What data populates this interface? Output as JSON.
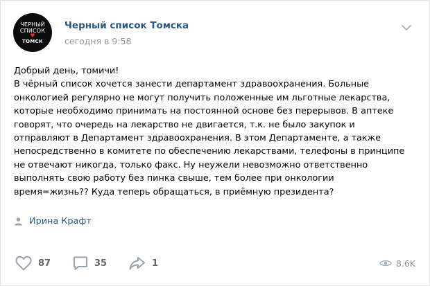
{
  "post": {
    "avatar": {
      "line1": "ЧЕРНЫЙ",
      "line2": "СПИСОК",
      "line3": "ТОМСК"
    },
    "author": "Черный список Томска",
    "date": "сегодня в 9:58",
    "text": "Добрый день, томичи!\nВ чёрный список хочется занести департамент здравоохранения. Больные\nонкологией регулярно не могут получить положенные им льготные лекарства,\nкоторые необходимо принимать на постоянной основе без перерывов. В аптеке\nговорят, что очередь на лекарство не двигается, т.к. не было закупок и\nотправляют в Департамент здравоохранения. В этом Департаменте, а также\nнепосредственно в комитете по обеспечению лекарствами, телефоны в принципе\nне отвечают никогда, только факс. Ну неужели невозможно ответственно\nвыполнять свою работу без пинка свыше, тем более при онкологии\nвремя=жизнь?? Куда теперь обращаться, в приёмную президента?",
    "signer": "Ирина Крафт"
  },
  "actions": {
    "likes": "87",
    "comments": "35",
    "shares": "1",
    "views": "8.6K"
  },
  "colors": {
    "link": "#2a5885",
    "muted": "#939393",
    "icon": "#99a2ad"
  }
}
